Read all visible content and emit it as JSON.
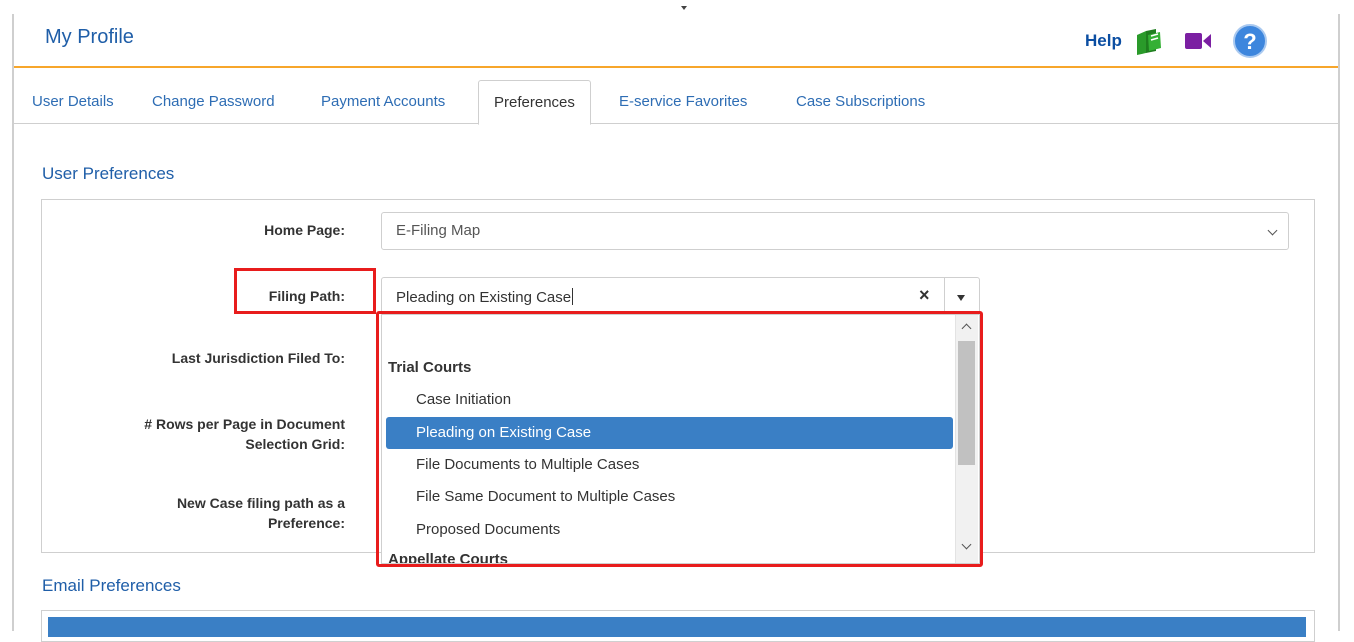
{
  "header": {
    "title": "My Profile",
    "help_label": "Help",
    "icons": [
      "help-book-icon",
      "video-icon",
      "question-icon"
    ]
  },
  "tabs": [
    {
      "label": "User Details"
    },
    {
      "label": "Change Password"
    },
    {
      "label": "Payment Accounts"
    },
    {
      "label": "Preferences",
      "active": true
    },
    {
      "label": "E-service Favorites"
    },
    {
      "label": "Case Subscriptions"
    }
  ],
  "user_preferences": {
    "title": "User Preferences",
    "labels": {
      "home_page": "Home Page:",
      "filing_path": "Filing Path:",
      "last_jurisdiction": "Last Jurisdiction Filed To:",
      "rows_line1": "# Rows per Page in Document",
      "rows_line2": "Selection Grid:",
      "new_case_line1": "New Case filing path as a",
      "new_case_line2": "Preference:"
    },
    "home_page_value": "E-Filing Map",
    "filing_path_value": "Pleading on Existing Case",
    "dropdown": {
      "group": "Trial Courts",
      "items": [
        "Case Initiation",
        "Pleading on Existing Case",
        "File Documents to Multiple Cases",
        "File Same Document to Multiple Cases",
        "Proposed Documents"
      ],
      "selected": "Pleading on Existing Case",
      "next_group_partial": "Appellate Courts"
    }
  },
  "email_preferences": {
    "title": "Email Preferences"
  },
  "colors": {
    "accent": "#1f5ea8",
    "tab_border": "#f7a62b",
    "highlight": "#e81c1c",
    "selected": "#3a7fc5",
    "help_book": "#2a9a2a",
    "video": "#7b1fa2",
    "question": "#3d86dd"
  }
}
